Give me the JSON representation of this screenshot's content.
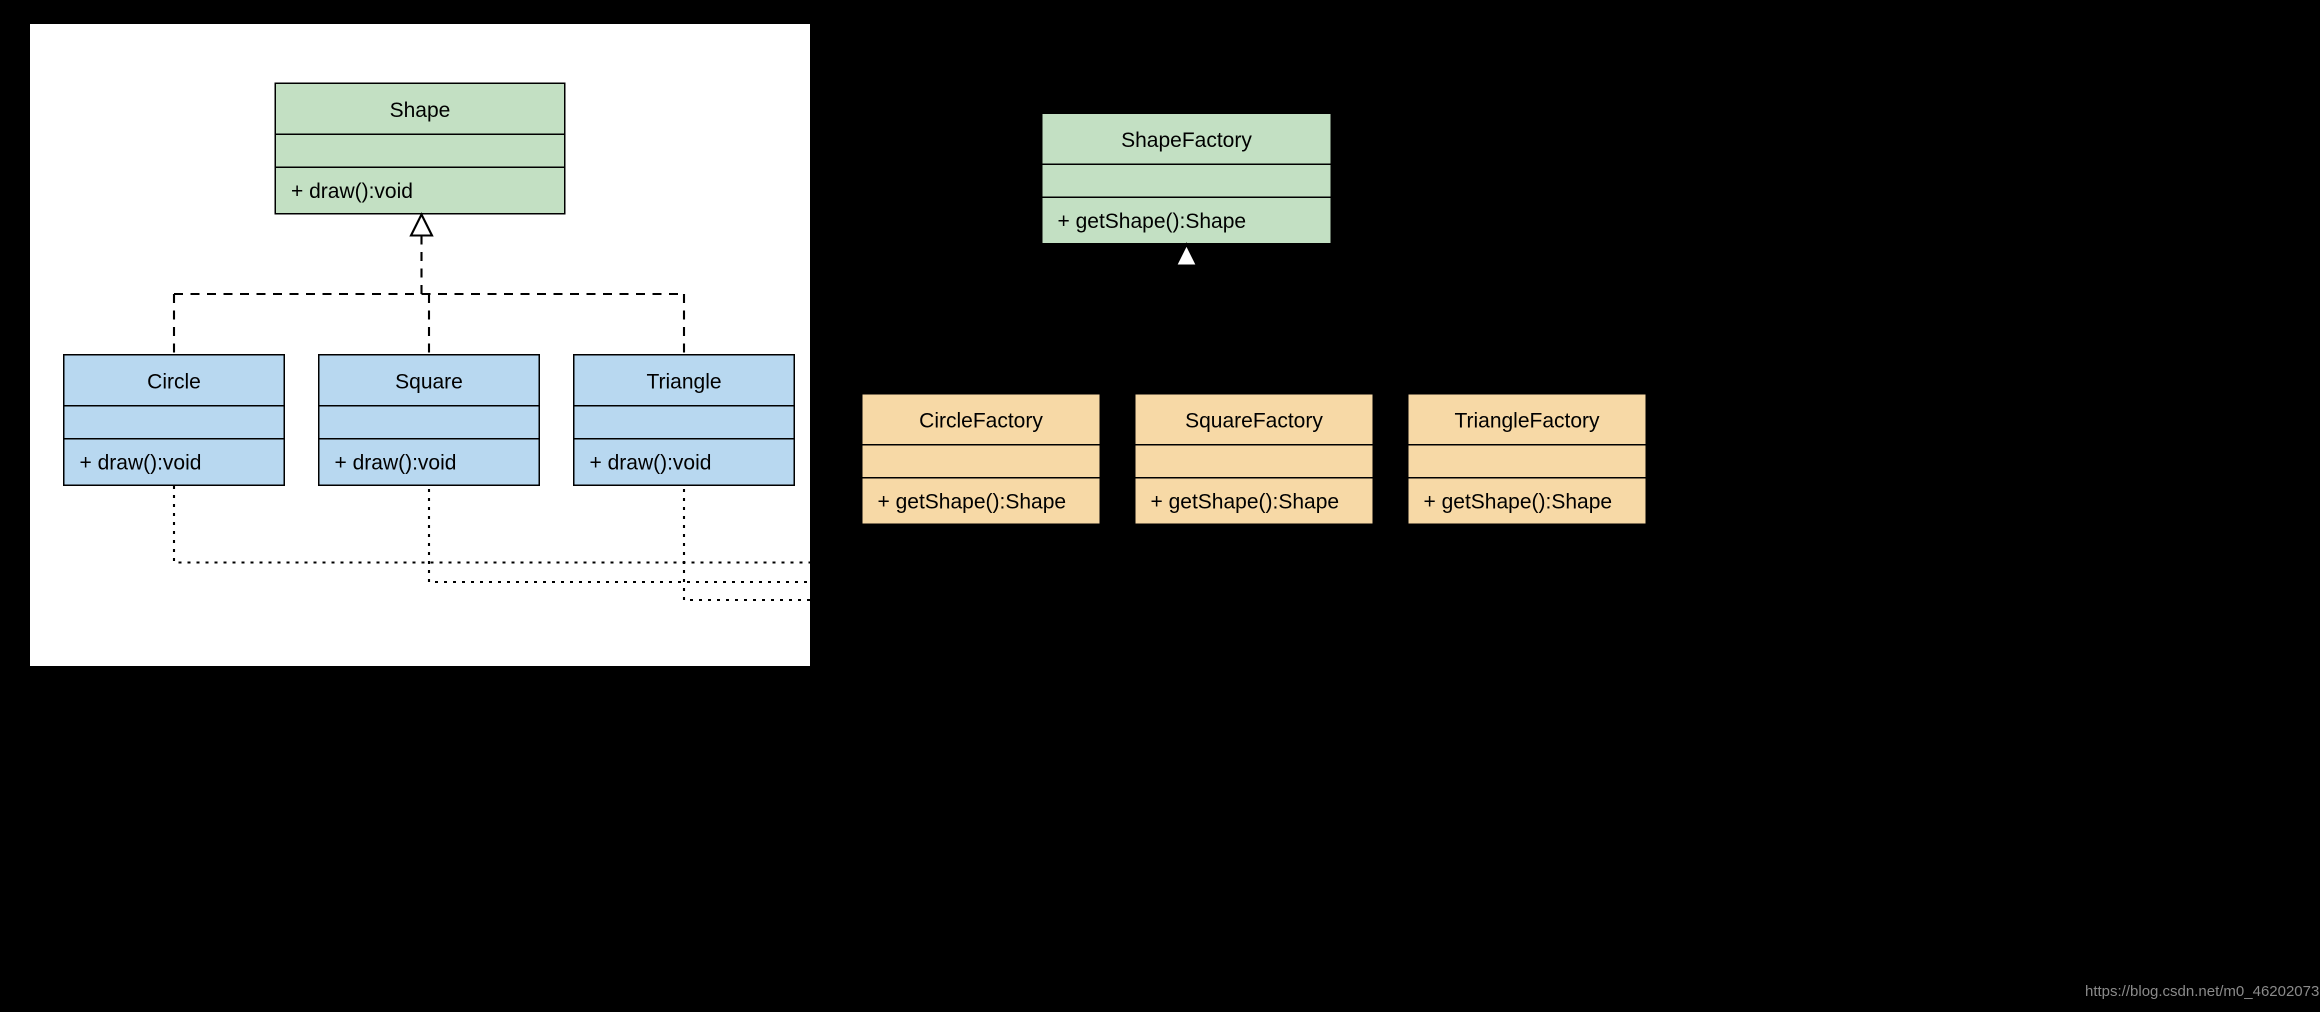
{
  "classes": {
    "shape": {
      "name": "Shape",
      "attrs": "",
      "ops": "+ draw():void"
    },
    "circle": {
      "name": "Circle",
      "attrs": "",
      "ops": "+ draw():void"
    },
    "square": {
      "name": "Square",
      "attrs": "",
      "ops": "+ draw():void"
    },
    "triangle": {
      "name": "Triangle",
      "attrs": "",
      "ops": "+ draw():void"
    },
    "shapeFactory": {
      "name": "ShapeFactory",
      "attrs": "",
      "ops": "+ getShape():Shape"
    },
    "circleFactory": {
      "name": "CircleFactory",
      "attrs": "",
      "ops": "+ getShape():Shape"
    },
    "squareFactory": {
      "name": "SquareFactory",
      "attrs": "",
      "ops": "+ getShape():Shape"
    },
    "triangleFactory": {
      "name": "TriangleFactory",
      "attrs": "",
      "ops": "+ getShape():Shape"
    }
  },
  "watermark": "https://blog.csdn.net/m0_46202073",
  "chart_data": {
    "type": "table",
    "description": "UML class diagram — Factory Method pattern. Abstract Shape and ShapeFactory each have three concrete subclasses; each concrete factory creates the corresponding shape.",
    "classes": [
      {
        "name": "Shape",
        "kind": "abstract",
        "operations": [
          "+ draw():void"
        ]
      },
      {
        "name": "Circle",
        "kind": "concrete",
        "operations": [
          "+ draw():void"
        ],
        "extends": "Shape"
      },
      {
        "name": "Square",
        "kind": "concrete",
        "operations": [
          "+ draw():void"
        ],
        "extends": "Shape"
      },
      {
        "name": "Triangle",
        "kind": "concrete",
        "operations": [
          "+ draw():void"
        ],
        "extends": "Shape"
      },
      {
        "name": "ShapeFactory",
        "kind": "abstract",
        "operations": [
          "+ getShape():Shape"
        ]
      },
      {
        "name": "CircleFactory",
        "kind": "concrete",
        "operations": [
          "+ getShape():Shape"
        ],
        "extends": "ShapeFactory"
      },
      {
        "name": "SquareFactory",
        "kind": "concrete",
        "operations": [
          "+ getShape():Shape"
        ],
        "extends": "ShapeFactory"
      },
      {
        "name": "TriangleFactory",
        "kind": "concrete",
        "operations": [
          "+ getShape():Shape"
        ],
        "extends": "ShapeFactory"
      }
    ],
    "relationships": [
      {
        "from": "Circle",
        "to": "Shape",
        "type": "realization"
      },
      {
        "from": "Square",
        "to": "Shape",
        "type": "realization"
      },
      {
        "from": "Triangle",
        "to": "Shape",
        "type": "realization"
      },
      {
        "from": "CircleFactory",
        "to": "ShapeFactory",
        "type": "generalization"
      },
      {
        "from": "SquareFactory",
        "to": "ShapeFactory",
        "type": "generalization"
      },
      {
        "from": "TriangleFactory",
        "to": "ShapeFactory",
        "type": "generalization"
      },
      {
        "from": "CircleFactory",
        "to": "Circle",
        "type": "dependency"
      },
      {
        "from": "SquareFactory",
        "to": "Square",
        "type": "dependency"
      },
      {
        "from": "TriangleFactory",
        "to": "Triangle",
        "type": "dependency"
      }
    ]
  }
}
